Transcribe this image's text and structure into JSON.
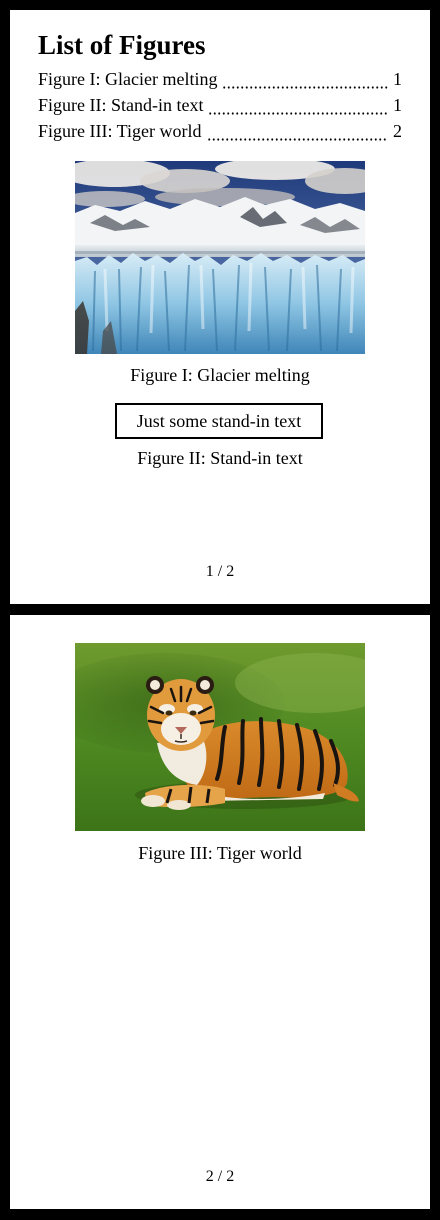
{
  "outline": {
    "title": "List of Figures",
    "entries": [
      {
        "title": "Figure I: Glacier melting",
        "page": "1"
      },
      {
        "title": "Figure II: Stand-in text",
        "page": "1"
      },
      {
        "title": "Figure III: Tiger world",
        "page": "2"
      }
    ]
  },
  "figures": {
    "glacier": {
      "caption": "Figure I: Glacier melting"
    },
    "stand_in": {
      "box_text": "Just some stand-in text",
      "caption": "Figure II: Stand-in text"
    },
    "tiger": {
      "caption": "Figure III: Tiger world"
    }
  },
  "pages": [
    {
      "number_label": "1 / 2"
    },
    {
      "number_label": "2 / 2"
    }
  ]
}
